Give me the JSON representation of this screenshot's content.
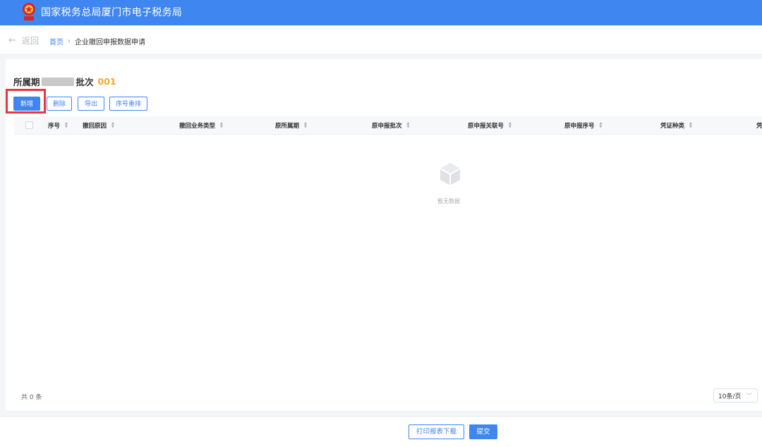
{
  "header": {
    "title": "国家税务总局厦门市电子税务局"
  },
  "nav": {
    "back_label": "返回",
    "breadcrumb_home": "首页",
    "breadcrumb_sep": "›",
    "breadcrumb_current": "企业撤回申报数据申请"
  },
  "period": {
    "label": "所属期",
    "batch_label": "批次",
    "batch_value": "001"
  },
  "toolbar": {
    "add_label": "新增",
    "delete_label": "删除",
    "export_label": "导出",
    "reorder_label": "序号重排"
  },
  "table": {
    "columns": [
      "序号",
      "撤回原因",
      "撤回业务类型",
      "原所属期",
      "原申报批次",
      "原申报关联号",
      "原申报序号",
      "凭证种类",
      "凭"
    ],
    "empty_text": "暂无数据"
  },
  "pagination": {
    "total": "共 0 条",
    "page_size": "10条/页"
  },
  "footer": {
    "print_label": "打印报表下载",
    "submit_label": "提交"
  },
  "colors": {
    "brand_blue": "#3f86f0",
    "highlight_red": "#e8373d",
    "batch_orange": "#f5a623"
  }
}
